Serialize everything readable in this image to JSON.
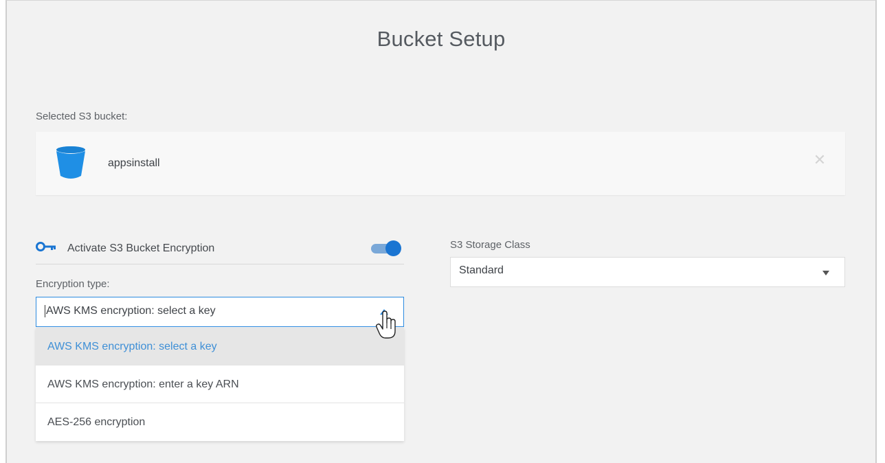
{
  "title": "Bucket Setup",
  "selected_bucket": {
    "label": "Selected S3 bucket:",
    "name": "appsinstall",
    "icon": "bucket-icon",
    "remove_icon": "close-icon"
  },
  "encryption": {
    "title": "Activate S3 Bucket Encryption",
    "enabled": true,
    "type_label": "Encryption type:",
    "selected_value": "AWS KMS encryption: select a key",
    "options": [
      {
        "label": "AWS KMS encryption: select a key",
        "selected": true
      },
      {
        "label": "AWS KMS encryption: enter a key ARN",
        "selected": false
      },
      {
        "label": "AES-256 encryption",
        "selected": false
      }
    ]
  },
  "storage_class": {
    "label": "S3 Storage Class",
    "value": "Standard"
  },
  "colors": {
    "accent": "#1a75d2",
    "bucket": "#1f8fe5",
    "selected_option_text": "#3e8fd6"
  }
}
